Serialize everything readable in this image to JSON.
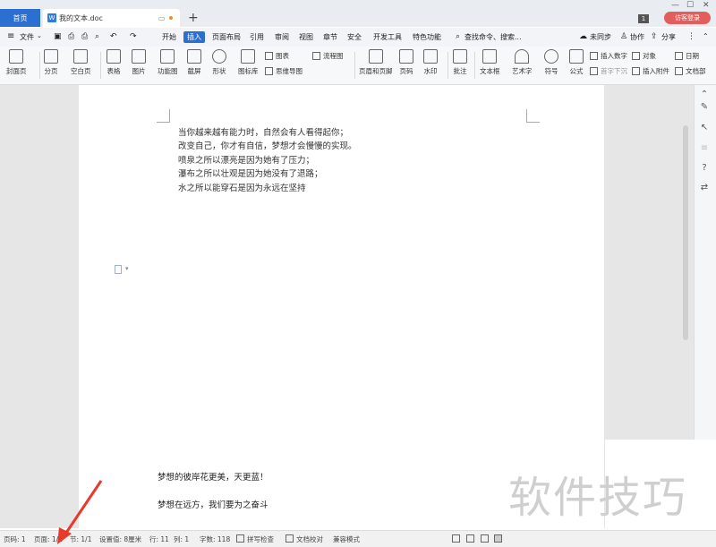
{
  "tabbar": {
    "home_tab": "首页",
    "doc_tab": "我的文本.doc",
    "doc_icon_text": "W",
    "new_tab_icon": "plus-icon",
    "badge": "1",
    "login": "访客登录"
  },
  "menubar": {
    "file": "文件",
    "items": [
      "开始",
      "插入",
      "页面布局",
      "引用",
      "审阅",
      "视图",
      "章节",
      "安全",
      "开发工具",
      "特色功能"
    ],
    "active": "插入",
    "search": "查找命令、搜索...",
    "sync": "未同步",
    "collab": "协作",
    "share": "分享"
  },
  "ribbon": {
    "cover": "封面页",
    "page_break": "分页",
    "blank_page": "空白页",
    "table": "表格",
    "picture": "图片",
    "function_chart": "功能图",
    "screenshot": "截屏",
    "shape": "形状",
    "icon_lib": "图标库",
    "chart": "图表",
    "mindmap": "思维导图",
    "flowchart": "流程图",
    "header_footer": "页眉和页脚",
    "page_num": "页码",
    "watermark": "水印",
    "comment": "批注",
    "textbox": "文本框",
    "wordart": "艺术字",
    "symbol": "符号",
    "formula": "公式",
    "insert_number": "插入数字",
    "object": "对象",
    "drop_cap": "首字下沉",
    "attachment": "插入附件",
    "date": "日期",
    "doc_parts": "文档部"
  },
  "document": {
    "lines": [
      "当你越来越有能力时，自然会有人看得起你；",
      "改变自己，你才有自信，梦想才会慢慢的实现。",
      "喷泉之所以漂亮是因为她有了压力；",
      "瀑布之所以壮观是因为她没有了退路；",
      "水之所以能穿石是因为永远在坚持"
    ],
    "bottom_lines": [
      "梦想的彼岸花更美，天更蓝！",
      "梦想在远方，我们要为之奋斗"
    ],
    "watermark": "软件技巧"
  },
  "status": {
    "page_num": "页码: 1",
    "pages": "页面: 1/1",
    "section": "节: 1/1",
    "setting": "设置值: 8厘米",
    "row": "行: 11",
    "col": "列: 1",
    "words": "字数: 118",
    "spell": "拼写检查",
    "proof": "文档校对",
    "compat": "兼容模式"
  },
  "colors": {
    "accent": "#2b6fd1",
    "login": "#e35d5d",
    "arrow": "#e8392b"
  }
}
